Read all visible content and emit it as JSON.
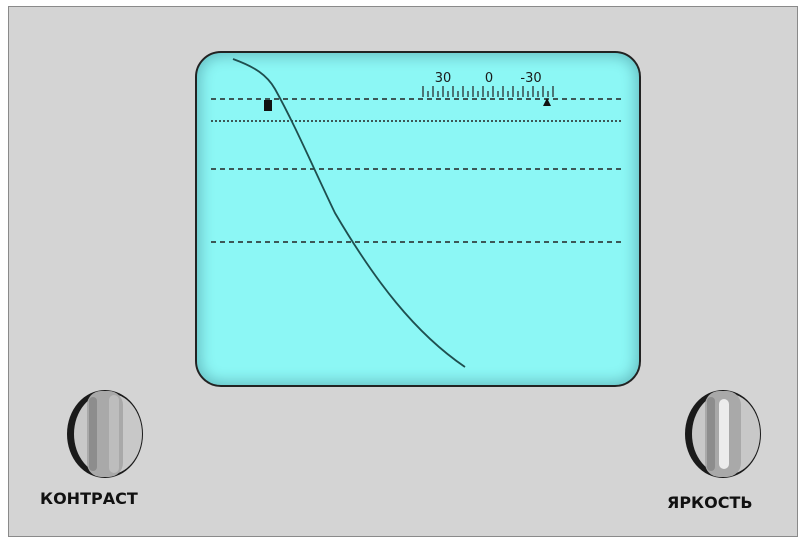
{
  "controls": {
    "contrast_label": "КОНТРАСТ",
    "brightness_label": "ЯРКОСТЬ"
  },
  "scale": {
    "labels": [
      "30",
      "0",
      "-30"
    ]
  },
  "icons": {
    "left_marker": "square-marker",
    "right_marker": "triangle-marker"
  },
  "colors": {
    "panel": "#d4d4d4",
    "screen": "#8cf7f5",
    "trace": "#1f4f4f"
  }
}
